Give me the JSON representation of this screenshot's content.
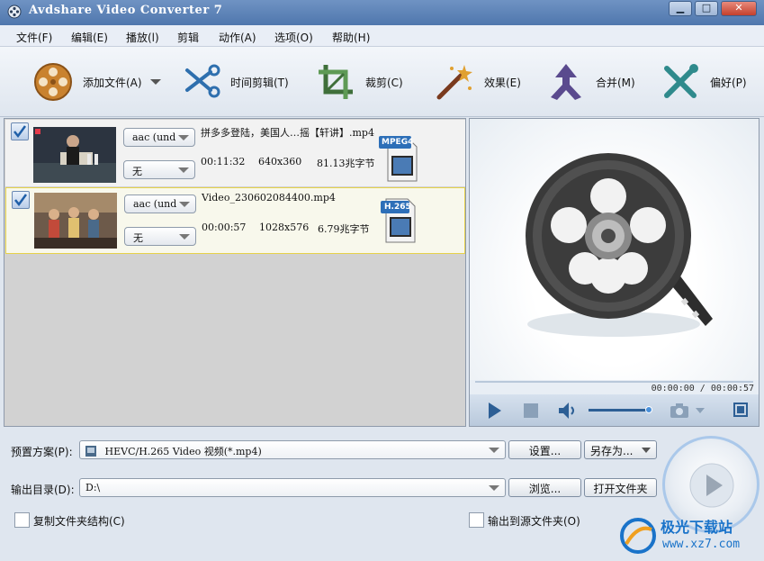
{
  "window": {
    "title": "Avdshare Video Converter 7",
    "min": "▁",
    "max": "□",
    "close": "✕"
  },
  "menu": [
    "文件(F)",
    "编辑(E)",
    "播放(l)",
    "剪辑",
    "动作(A)",
    "选项(O)",
    "帮助(H)"
  ],
  "toolbar": {
    "add_file": "添加文件(A)",
    "trim": "时间剪辑(T)",
    "crop": "裁剪(C)",
    "effect": "效果(E)",
    "merge": "合并(M)",
    "preferences": "偏好(P)"
  },
  "files": [
    {
      "checked": true,
      "audio": "aac (und",
      "subtitle": "无",
      "name": "拼多多登陆，美国人…摇【轩讲】.mp4",
      "duration": "00:11:32",
      "resolution": "640x360",
      "size": "81.13兆字节",
      "format_badge": "MPEG4"
    },
    {
      "checked": true,
      "audio": "aac (und",
      "subtitle": "无",
      "name": "Video_230602084400.mp4",
      "duration": "00:00:57",
      "resolution": "1028x576",
      "size": "6.79兆字节",
      "format_badge": "H.265"
    }
  ],
  "player": {
    "time": "00:00:00 / 00:00:57",
    "volume_level": 0.95
  },
  "output": {
    "preset_label": "预置方案(P):",
    "preset_value": "HEVC/H.265 Video 视频(*.mp4)",
    "settings_btn": "设置...",
    "save_as_btn": "另存为...",
    "dir_label": "输出目录(D):",
    "dir_value": "D:\\",
    "browse_btn": "浏览...",
    "open_folder_btn": "打开文件夹",
    "copy_structure": "复制文件夹结构(C)",
    "output_to_source": "输出到源文件夹(O)"
  },
  "watermark": {
    "line1": "极光下载站",
    "line2": "www.xz7.com"
  },
  "colors": {
    "titlebar": "#4f77ad",
    "selected_border": "#e6d24a",
    "accent": "#1a73c9"
  }
}
